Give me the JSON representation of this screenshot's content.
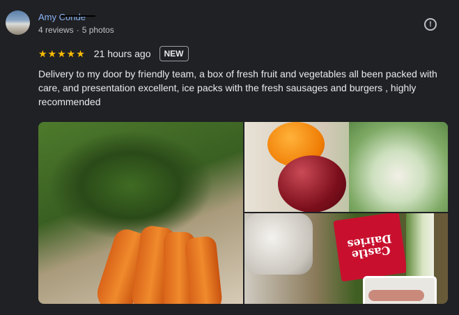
{
  "reviewer": {
    "name": "Amy Conde",
    "meta_reviews": "4 reviews",
    "meta_separator": "·",
    "meta_photos": "5 photos"
  },
  "rating": {
    "stars": "★★★★★",
    "value": 5,
    "max": 5,
    "time": "21 hours ago",
    "badge": "NEW"
  },
  "review_text": "Delivery to my door by friendly team, a box of fresh fruit and vegetables all been packed with care, and presentation excellent, ice packs with the fresh sausages and burgers , highly recommended",
  "report_icon": "!",
  "photo_labels": {
    "castle_dairies": "Castle Dairies"
  },
  "colors": {
    "background": "#202124",
    "name_link": "#8ab4f8",
    "star": "#fbbc04",
    "text": "#e8eaed",
    "muted": "#bdc1c6"
  }
}
